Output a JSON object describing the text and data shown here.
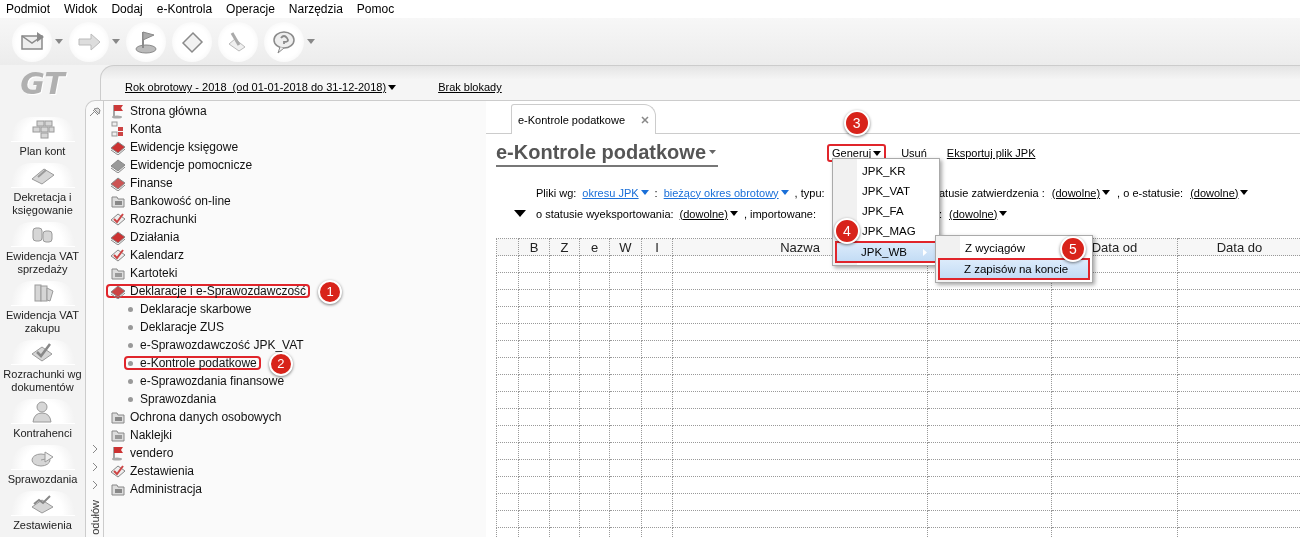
{
  "menu_bar": [
    "Podmiot",
    "Widok",
    "Dodaj",
    "e-Kontrola",
    "Operacje",
    "Narzędzia",
    "Pomoc"
  ],
  "logo": "GT",
  "modules": [
    {
      "label": "Plan kont"
    },
    {
      "label": "Dekretacja i księgowanie"
    },
    {
      "label": "Ewidencja VAT sprzedaży"
    },
    {
      "label": "Ewidencja VAT zakupu"
    },
    {
      "label": "Rozrachunki wg dokumentów"
    },
    {
      "label": "Kontrahenci"
    },
    {
      "label": "Sprawozdania"
    },
    {
      "label": "Zestawienia"
    }
  ],
  "period": "Rok obrotowy - 2018  (od 01-01-2018 do 31-12-2018)",
  "lock_status": "Brak blokady",
  "modules_strip_label": "odułów",
  "tree": [
    {
      "label": "Strona główna"
    },
    {
      "label": "Konta"
    },
    {
      "label": "Ewidencje księgowe"
    },
    {
      "label": "Ewidencje pomocnicze"
    },
    {
      "label": "Finanse"
    },
    {
      "label": "Bankowość on-line"
    },
    {
      "label": "Rozrachunki"
    },
    {
      "label": "Działania"
    },
    {
      "label": "Kalendarz"
    },
    {
      "label": "Kartoteki"
    },
    {
      "label": "Deklaracje i e-Sprawozdawczość",
      "callout": "1",
      "children": [
        {
          "label": "Deklaracje skarbowe"
        },
        {
          "label": "Deklaracje ZUS"
        },
        {
          "label": "e-Sprawozdawczość JPK_VAT"
        },
        {
          "label": "e-Kontrole podatkowe",
          "callout": "2"
        },
        {
          "label": "e-Sprawozdania finansowe"
        },
        {
          "label": "Sprawozdania"
        }
      ]
    },
    {
      "label": "Ochrona danych osobowych"
    },
    {
      "label": "Naklejki"
    },
    {
      "label": "vendero"
    },
    {
      "label": "Zestawienia"
    },
    {
      "label": "Administracja"
    }
  ],
  "tab": {
    "label": "e-Kontrole podatkowe"
  },
  "page_title": "e-Kontrole podatkowe",
  "actions": [
    {
      "label": "Generuj",
      "dropdown": true,
      "callout": "3"
    },
    {
      "label": "Usuń",
      "dropdown": false
    },
    {
      "label": "Eksportuj plik JPK",
      "dropdown": false
    }
  ],
  "filters": [
    {
      "left": [
        {
          "kind": "label",
          "text": "Pliki wg:"
        },
        {
          "kind": "link",
          "text": "okresu JPK"
        },
        {
          "kind": "label",
          "text": ":"
        },
        {
          "kind": "link",
          "text": "bieżący okres obrotowy"
        },
        {
          "kind": "label",
          "text": ", typu:"
        }
      ],
      "right": [
        {
          "kind": "label",
          "text": "atusie zatwierdzenia :"
        },
        {
          "kind": "dropdown",
          "text": "(dowolne)"
        },
        {
          "kind": "label",
          "text": ", o e-statusie:"
        },
        {
          "kind": "dropdown",
          "text": "(dowolne)"
        }
      ]
    },
    {
      "left": [
        {
          "kind": "label",
          "text": "o statusie wyeksportowania:"
        },
        {
          "kind": "dropdown",
          "text": "(dowolne)"
        },
        {
          "kind": "label",
          "text": ", importowane:"
        }
      ],
      "right": [
        {
          "kind": "label",
          "text": ":"
        },
        {
          "kind": "dropdown",
          "text": "(dowolne)"
        }
      ]
    }
  ],
  "table": {
    "columns": [
      {
        "kind": "text",
        "label": "B"
      },
      {
        "kind": "text",
        "label": "Z"
      },
      {
        "kind": "text",
        "label": "e"
      },
      {
        "kind": "text",
        "label": "W"
      },
      {
        "kind": "text",
        "label": "I"
      },
      {
        "kind": "text",
        "label": "Nazwa"
      },
      {
        "kind": "blank"
      },
      {
        "kind": "text",
        "label": "Data od"
      },
      {
        "kind": "text",
        "label": "Data do"
      }
    ]
  },
  "generate_menu": [
    {
      "label": "JPK_KR",
      "selected": false,
      "submenu": false
    },
    {
      "label": "JPK_VAT",
      "selected": false,
      "submenu": false
    },
    {
      "label": "JPK_FA",
      "selected": false,
      "submenu": false
    },
    {
      "label": "JPK_MAG",
      "selected": false,
      "submenu": false
    },
    {
      "label": "JPK_WB",
      "selected": true,
      "submenu": true,
      "callout": "4"
    }
  ],
  "jpk_wb_submenu": [
    {
      "label": "Z wyciągów",
      "selected": false
    },
    {
      "label": "Z zapisów na koncie",
      "selected": true,
      "callout": "5"
    }
  ]
}
